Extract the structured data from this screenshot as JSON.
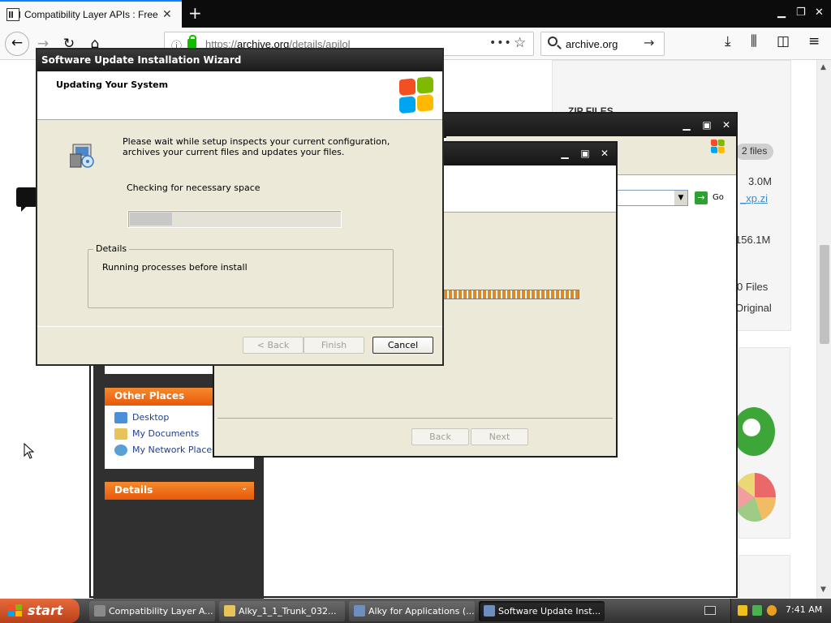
{
  "browser": {
    "tab_title": "Compatibility Layer APIs : Free Do",
    "tab_close": "✕",
    "new_tab": "+",
    "url_prefix": "https://",
    "url_domain": "archive.org",
    "url_path": "/details/apilol",
    "search_text": "archive.org",
    "icons": [
      "back-arrow-icon",
      "forward-arrow-icon",
      "reload-icon",
      "home-icon",
      "info-icon",
      "lock-icon",
      "page-actions-icon",
      "bookmark-star-icon",
      "search-icon",
      "search-go-icon",
      "download-icon",
      "library-icon",
      "sidebar-icon",
      "menu-icon"
    ]
  },
  "archive": {
    "zip_files": "ZIP FILES",
    "files_badge": "2 files",
    "size1": "3.0M",
    "link1": "_xp.zi",
    "size2": "156.1M",
    "files_count": "0 Files",
    "original": "Original"
  },
  "explorer": {
    "other_places_title": "Other Places",
    "places": [
      "Desktop",
      "My Documents",
      "My Network Places"
    ],
    "details_title": "Details",
    "go_label": "Go"
  },
  "alky": {
    "back_label": "Back",
    "next_label": "Next"
  },
  "wizard": {
    "title": "Software Update Installation Wizard",
    "header_title": "Updating Your System",
    "message": "Please wait while setup inspects your current configuration, archives your current files and updates your files.",
    "status": "Checking for necessary space",
    "progress": 0.2,
    "details_label": "Details",
    "details_text": "Running processes before install",
    "back_label": "< Back",
    "finish_label": "Finish",
    "cancel_label": "Cancel"
  },
  "taskbar": {
    "start_label": "start",
    "tasks": [
      "Compatibility Layer A...",
      "Alky_1_1_Trunk_032...",
      "Alky for Applications (...",
      "Software Update Inst..."
    ],
    "clock": "7:41 AM"
  },
  "colors": {
    "accent_tab": "#0a84ff",
    "xp_orange": "#e8580c",
    "secure_lock": "#12bc00",
    "title_bar": "#1a1a1a"
  }
}
